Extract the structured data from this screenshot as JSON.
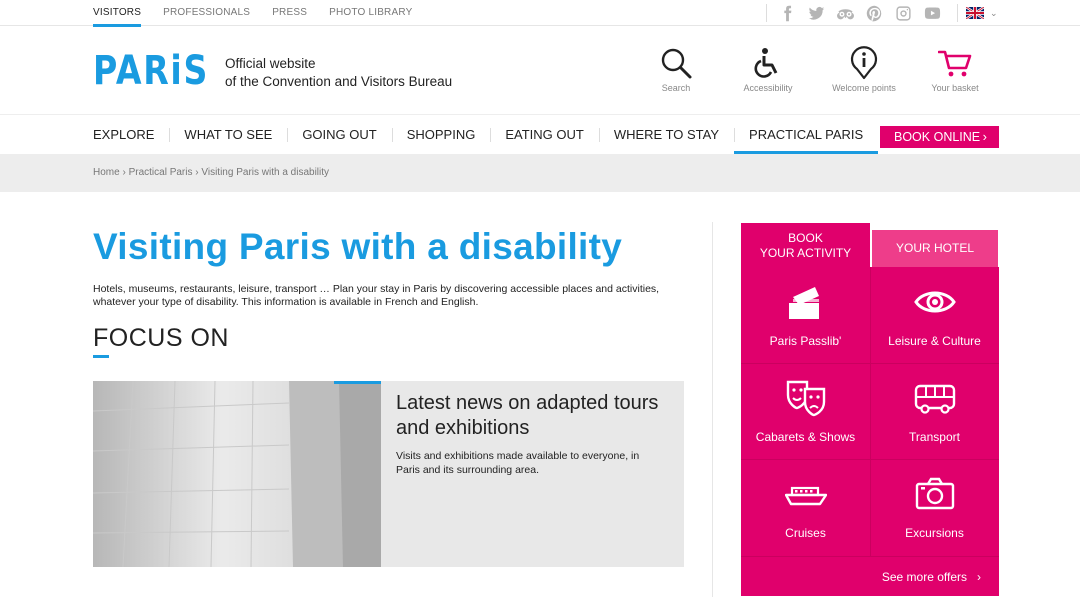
{
  "topnav": {
    "items": [
      {
        "label": "VISITORS",
        "active": true
      },
      {
        "label": "PROFESSIONALS"
      },
      {
        "label": "PRESS"
      },
      {
        "label": "PHOTO LIBRARY"
      }
    ]
  },
  "social": [
    "facebook-icon",
    "twitter-icon",
    "tripadvisor-icon",
    "pinterest-icon",
    "instagram-icon",
    "youtube-icon"
  ],
  "language": {
    "selected": "uk-flag-icon"
  },
  "header": {
    "logo": "PARiS",
    "official_line1": "Official website",
    "official_line2": "of the Convention and Visitors Bureau",
    "icons": [
      {
        "name": "search-icon",
        "label": "Search"
      },
      {
        "name": "accessibility-icon",
        "label": "Accessibility"
      },
      {
        "name": "welcome-points-icon",
        "label": "Welcome points"
      },
      {
        "name": "basket-icon",
        "label": "Your basket"
      }
    ]
  },
  "mainnav": {
    "items": [
      "EXPLORE",
      "WHAT TO SEE",
      "GOING OUT",
      "SHOPPING",
      "EATING OUT",
      "WHERE TO STAY",
      "PRACTICAL PARIS"
    ],
    "active_index": 6,
    "book_online": "BOOK ONLINE"
  },
  "breadcrumb": [
    "Home",
    "Practical Paris",
    "Visiting Paris with a disability"
  ],
  "main": {
    "title": "Visiting Paris with a disability",
    "intro": "Hotels, museums, restaurants, leisure, transport … Plan your stay in Paris by discovering accessible places and activities, whatever your type of disability. This information is available in French and English.",
    "focus_heading": "FOCUS ON",
    "card": {
      "title": "Latest news on adapted tours and exhibitions",
      "text": "Visits and exhibitions made available to everyone, in Paris and its surrounding area."
    }
  },
  "booking": {
    "tab_activity": "BOOK\nYOUR ACTIVITY",
    "tab_activity_line1": "BOOK",
    "tab_activity_line2": "YOUR ACTIVITY",
    "tab_hotel": "YOUR HOTEL",
    "cells": [
      {
        "label": "Paris Passlib'"
      },
      {
        "label": "Leisure & Culture"
      },
      {
        "label": "Cabarets & Shows"
      },
      {
        "label": "Transport"
      },
      {
        "label": "Cruises"
      },
      {
        "label": "Excursions"
      }
    ],
    "more": "See more offers"
  },
  "colors": {
    "accent_blue": "#1a9be0",
    "brand_pink": "#e0006c"
  }
}
